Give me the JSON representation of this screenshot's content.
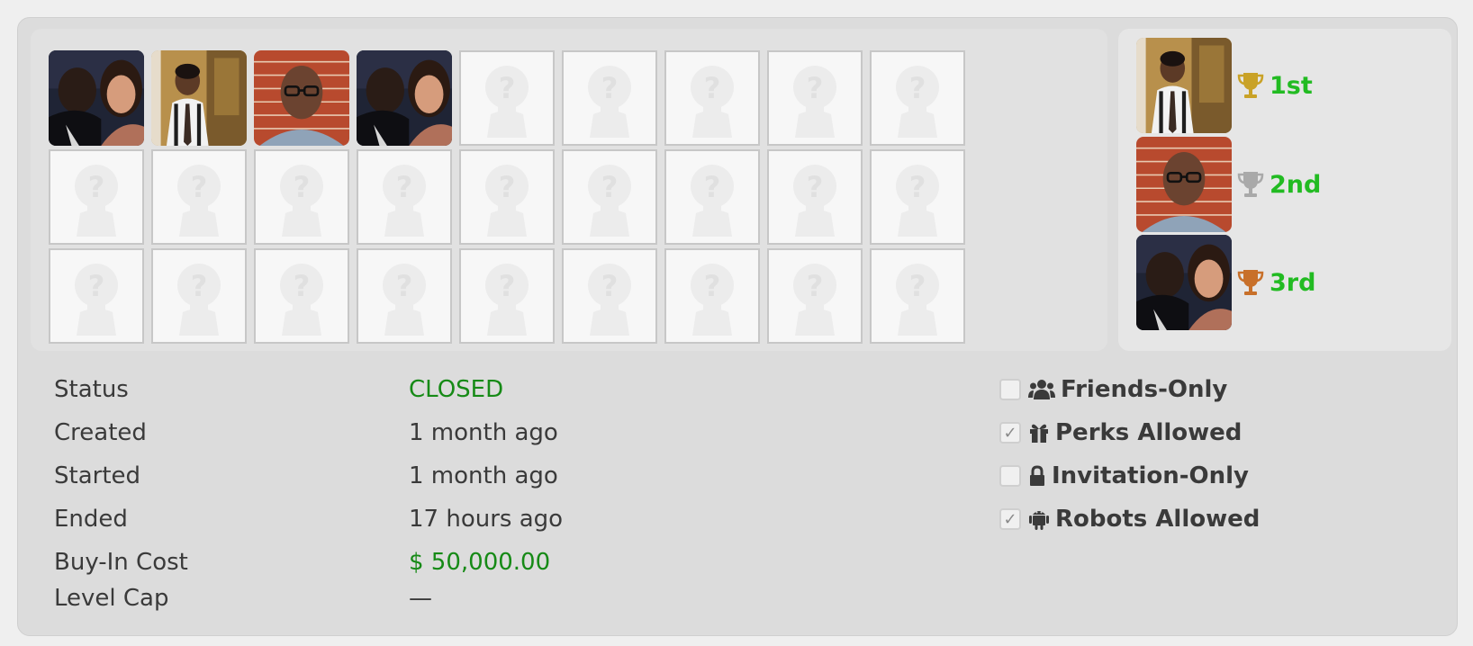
{
  "participants": {
    "slots": [
      {
        "kind": "photo",
        "photo": "couple"
      },
      {
        "kind": "photo",
        "photo": "man-tie"
      },
      {
        "kind": "photo",
        "photo": "man-glasses"
      },
      {
        "kind": "photo",
        "photo": "couple"
      },
      {
        "kind": "empty"
      },
      {
        "kind": "empty"
      },
      {
        "kind": "empty"
      },
      {
        "kind": "empty"
      },
      {
        "kind": "empty"
      },
      {
        "kind": "empty"
      },
      {
        "kind": "empty"
      },
      {
        "kind": "empty"
      },
      {
        "kind": "empty"
      },
      {
        "kind": "empty"
      },
      {
        "kind": "empty"
      },
      {
        "kind": "empty"
      },
      {
        "kind": "empty"
      },
      {
        "kind": "empty"
      },
      {
        "kind": "empty"
      },
      {
        "kind": "empty"
      },
      {
        "kind": "empty"
      },
      {
        "kind": "empty"
      },
      {
        "kind": "empty"
      },
      {
        "kind": "empty"
      },
      {
        "kind": "empty"
      },
      {
        "kind": "empty"
      },
      {
        "kind": "empty"
      }
    ]
  },
  "winners": [
    {
      "place": "1st",
      "photo": "man-tie",
      "trophy": "gold-trophy-icon",
      "trophy_color": "#c9a227"
    },
    {
      "place": "2nd",
      "photo": "man-glasses",
      "trophy": "silver-trophy-icon",
      "trophy_color": "#a9a9a9"
    },
    {
      "place": "3rd",
      "photo": "couple",
      "trophy": "bronze-trophy-icon",
      "trophy_color": "#c8702a"
    }
  ],
  "details": {
    "status_label": "Status",
    "status_value": "CLOSED",
    "created_label": "Created",
    "created_value": "1 month ago",
    "started_label": "Started",
    "started_value": "1 month ago",
    "ended_label": "Ended",
    "ended_value": "17 hours ago",
    "buyin_label": "Buy-In Cost",
    "buyin_value": "$ 50,000.00",
    "levelcap_label": "Level Cap",
    "levelcap_value": "—"
  },
  "options": [
    {
      "label": "Friends-Only",
      "checked": false,
      "icon": "users-icon"
    },
    {
      "label": "Perks Allowed",
      "checked": true,
      "icon": "gift-icon"
    },
    {
      "label": "Invitation-Only",
      "checked": false,
      "icon": "lock-icon"
    },
    {
      "label": "Robots Allowed",
      "checked": true,
      "icon": "android-icon"
    }
  ],
  "colors": {
    "accent_green": "#22bb22",
    "value_green": "#168a16",
    "panel_bg": "#dcdcdc"
  }
}
